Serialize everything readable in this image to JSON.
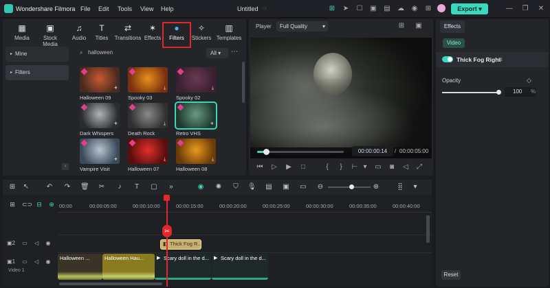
{
  "app": {
    "name": "Wondershare Filmora",
    "project": "Untitled",
    "export_label": "Export"
  },
  "menu": [
    "File",
    "Edit",
    "Tools",
    "View",
    "Help"
  ],
  "tabs": [
    {
      "label": "Media",
      "icon": "media-icon"
    },
    {
      "label": "Stock Media",
      "icon": "stock-media-icon"
    },
    {
      "label": "Audio",
      "icon": "audio-icon"
    },
    {
      "label": "Titles",
      "icon": "titles-icon"
    },
    {
      "label": "Transitions",
      "icon": "transitions-icon"
    },
    {
      "label": "Effects",
      "icon": "effects-icon"
    },
    {
      "label": "Filters",
      "icon": "filters-icon",
      "active": true
    },
    {
      "label": "Stickers",
      "icon": "stickers-icon"
    },
    {
      "label": "Templates",
      "icon": "templates-icon"
    }
  ],
  "sidebar": [
    "Mine",
    "Filters"
  ],
  "search": {
    "value": "halloween",
    "filter": "All"
  },
  "thumbnails": [
    {
      "label": "Halloween 09",
      "colors": [
        "#4a2a20",
        "#c85a30"
      ],
      "badge": "plus"
    },
    {
      "label": "Spooky 03",
      "colors": [
        "#7a3010",
        "#e8901a"
      ],
      "badge": "download"
    },
    {
      "label": "Spooky 02",
      "colors": [
        "#3a2030",
        "#6a3a50"
      ],
      "badge": "download"
    },
    {
      "label": "Dark Whispers",
      "colors": [
        "#2a2c2e",
        "#b0b4b8"
      ],
      "badge": "plus"
    },
    {
      "label": "Death Rock",
      "colors": [
        "#303030",
        "#8a8a8a"
      ],
      "badge": "download"
    },
    {
      "label": "Retro VHS",
      "colors": [
        "#1e3a30",
        "#6a9a80"
      ],
      "badge": "plus",
      "selected": true
    },
    {
      "label": "Vampire Visit",
      "colors": [
        "#3a4a5a",
        "#b8c4d0"
      ],
      "badge": "plus"
    },
    {
      "label": "Halloween 07",
      "colors": [
        "#5a0e0e",
        "#e0302a"
      ],
      "badge": "download"
    },
    {
      "label": "Halloween 08",
      "colors": [
        "#6a3a08",
        "#e89a20"
      ],
      "badge": "download"
    }
  ],
  "player": {
    "label": "Player",
    "quality": "Full Quality",
    "current_time": "00:00:00:14",
    "total_time": "00:00:05:00",
    "progress": 0.1
  },
  "effects_panel": {
    "tab": "Effects",
    "subtab": "Video",
    "effect_name": "Thick Fog Right",
    "opacity_label": "Opacity",
    "opacity_value": "100",
    "opacity_unit": "%",
    "opacity_level": 1.0,
    "reset_label": "Reset"
  },
  "timeline": {
    "ruler": [
      "00:00",
      "00:00:05:00",
      "00:00:10:00",
      "00:00:15:00",
      "00:00:20:00",
      "00:00:25:00",
      "00:00:30:00",
      "00:00:35:00",
      "00:00:40:00"
    ],
    "track2_num": "2",
    "track1_num": "1",
    "track1_label": "Video 1",
    "effect_clip": "Thick Fog R...",
    "clips": [
      {
        "label": "Halloween ...",
        "color": "#3a3426"
      },
      {
        "label": "Halloween Hau...",
        "color": "#8a7a20"
      },
      {
        "label": "Scary doll in the d...",
        "color": "#1e2a2a"
      },
      {
        "label": "Scary doll in the d...",
        "color": "#1e2a2a"
      }
    ],
    "zoom_level": 0.55
  }
}
